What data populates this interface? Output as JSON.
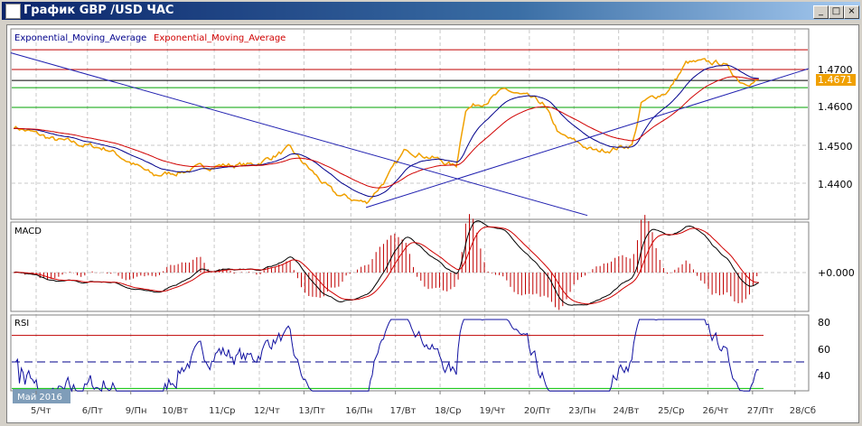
{
  "window": {
    "title": "График GBP /USD  ЧАС",
    "buttons": [
      "_",
      "□",
      "×"
    ]
  },
  "legend": {
    "ema1": "Exponential_Moving_Average",
    "ema2": "Exponential_Moving_Average"
  },
  "colors": {
    "price": "#f0a000",
    "ema1": "#00008b",
    "ema2": "#d00000",
    "up": "#d00000",
    "down": "#00a000",
    "current": "#f0a000"
  },
  "price_axis": {
    "labels": [
      "1.4700",
      "1.4600",
      "1.4500",
      "1.4400"
    ],
    "current": "1.4671"
  },
  "levels": {
    "red": [
      1.4752,
      1.47
    ],
    "black": 1.4671,
    "green": [
      1.4652,
      1.46
    ]
  },
  "price_path": [
    [
      -0.5,
      1.455
    ],
    [
      0.4,
      1.4514
    ],
    [
      1.62,
      1.449
    ],
    [
      2.63,
      1.4419
    ],
    [
      3.24,
      1.4431
    ],
    [
      4.05,
      1.4448
    ],
    [
      4.86,
      1.4448
    ],
    [
      5.67,
      1.449
    ],
    [
      6.07,
      1.4443
    ],
    [
      6.68,
      1.4371
    ],
    [
      7.39,
      1.4348
    ],
    [
      7.89,
      1.4419
    ],
    [
      8.3,
      1.449
    ],
    [
      8.91,
      1.4467
    ],
    [
      9.41,
      1.4443
    ],
    [
      9.62,
      1.4598
    ],
    [
      9.92,
      1.461
    ],
    [
      10.53,
      1.4645
    ],
    [
      11.34,
      1.461
    ],
    [
      11.74,
      1.4526
    ],
    [
      12.55,
      1.4483
    ],
    [
      13.36,
      1.4502
    ],
    [
      13.56,
      1.461
    ],
    [
      14.17,
      1.4645
    ],
    [
      14.57,
      1.4717
    ],
    [
      15.38,
      1.4717
    ],
    [
      15.79,
      1.4669
    ],
    [
      16.19,
      1.4671
    ]
  ],
  "trendlines": [
    [
      [
        -0.57,
        1.4744
      ],
      [
        12.35,
        1.4315
      ]
    ],
    [
      [
        7.39,
        1.4336
      ],
      [
        17.3,
        1.4702
      ]
    ]
  ],
  "macd": {
    "label": "MACD",
    "zero": "+0.000"
  },
  "rsi": {
    "label": "RSI",
    "levels": [
      "80",
      "60",
      "40"
    ]
  },
  "xaxis": {
    "period": "Май 2016",
    "days": [
      "5/Чт",
      "6/Пт",
      "9/Пн",
      "10/Вт",
      "11/Ср",
      "12/Чт",
      "13/Пт",
      "16/Пн",
      "17/Вт",
      "18/Ср",
      "19/Чт",
      "20/Пт",
      "23/Пн",
      "24/Вт",
      "25/Ср",
      "26/Чт",
      "27/Пт",
      "28/Сб"
    ]
  }
}
